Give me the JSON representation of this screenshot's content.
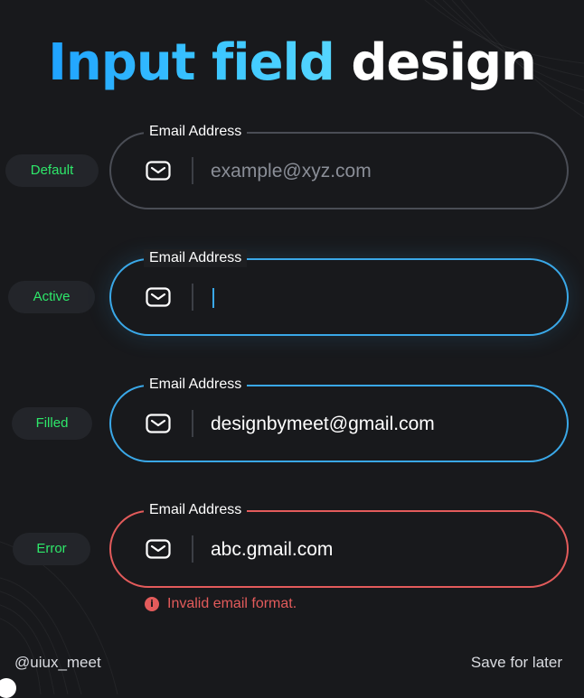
{
  "title": {
    "accent": "Input field design",
    "accent_part": "Input field",
    "rest_part": "design"
  },
  "fields": [
    {
      "state": "Default",
      "label": "Email Address",
      "value": "example@xyz.com",
      "is_placeholder": true,
      "icon": "mail-icon"
    },
    {
      "state": "Active",
      "label": "Email Address",
      "value": "",
      "is_placeholder": false,
      "icon": "mail-icon"
    },
    {
      "state": "Filled",
      "label": "Email Address",
      "value": "designbymeet@gmail.com",
      "is_placeholder": false,
      "icon": "mail-icon"
    },
    {
      "state": "Error",
      "label": "Email Address",
      "value": "abc.gmail.com",
      "is_placeholder": false,
      "icon": "mail-icon"
    }
  ],
  "error_message": "Invalid email format.",
  "error_icon_glyph": "i",
  "footer": {
    "handle": "@uiux_meet",
    "save_label": "Save for later"
  },
  "colors": {
    "accent_blue": "#3aa8e8",
    "error_red": "#e35b5b",
    "state_green": "#2ee86a",
    "background": "#18191c"
  }
}
